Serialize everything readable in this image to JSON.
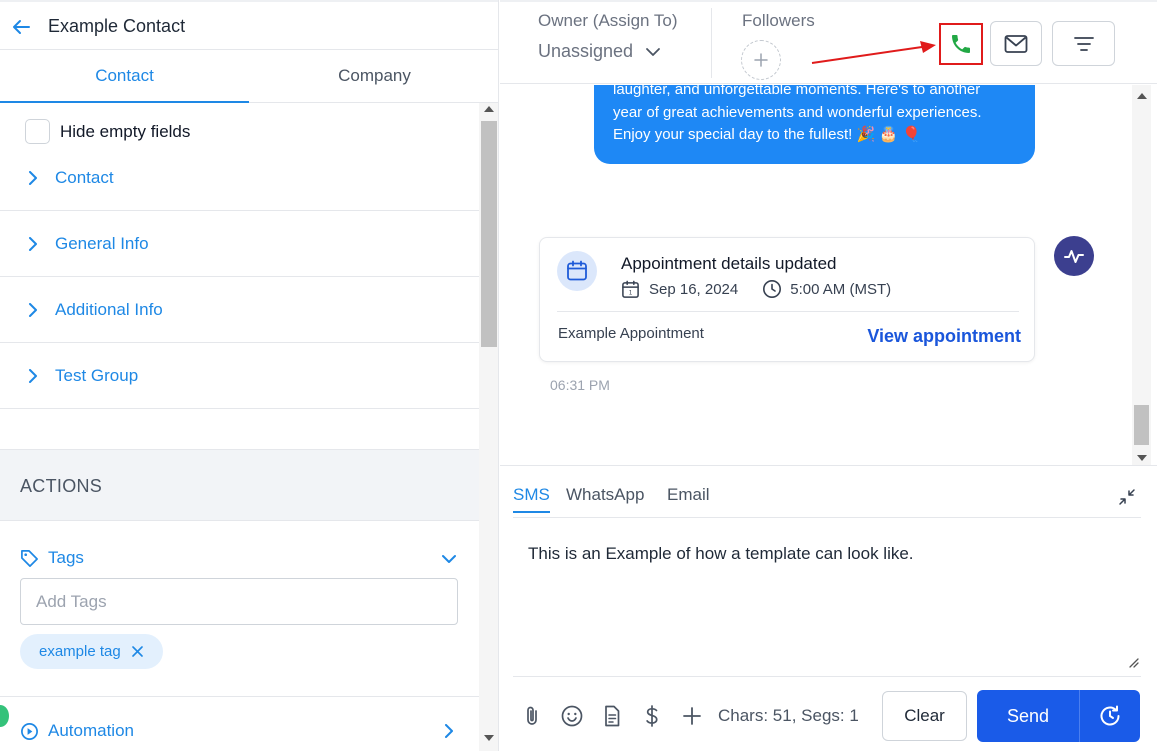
{
  "contact": {
    "name": "Example Contact",
    "tabs": [
      {
        "label": "Contact"
      },
      {
        "label": "Company"
      }
    ],
    "hide_empty_label": "Hide empty fields",
    "sections": [
      {
        "label": "Contact"
      },
      {
        "label": "General Info"
      },
      {
        "label": "Additional Info"
      },
      {
        "label": "Test Group"
      }
    ]
  },
  "actions": {
    "header": "ACTIONS",
    "tags_label": "Tags",
    "tags_placeholder": "Add Tags",
    "tags": [
      {
        "label": "example tag"
      }
    ],
    "automation_label": "Automation"
  },
  "header": {
    "owner_label": "Owner (Assign To)",
    "owner_value": "Unassigned",
    "followers_label": "Followers"
  },
  "conversation": {
    "message_lines": [
      "laughter, and unforgettable moments. Here's to another",
      "year of great achievements and wonderful experiences.",
      "Enjoy your special day to the fullest! 🎉 🎂 🎈"
    ],
    "activity": {
      "title": "Appointment details updated",
      "date": "Sep 16, 2024",
      "time": "5:00 AM (MST)",
      "appointment_name": "Example Appointment",
      "link_label": "View appointment"
    },
    "timestamp": "06:31 PM"
  },
  "composer": {
    "tabs": [
      {
        "label": "SMS"
      },
      {
        "label": "WhatsApp"
      },
      {
        "label": "Email"
      }
    ],
    "message": "This is an Example of how a template can look like.",
    "char_count": "Chars: 51, Segs: 1",
    "clear_label": "Clear",
    "send_label": "Send"
  },
  "colors": {
    "accent": "#1e88e5",
    "send": "#1a5be8",
    "bubble": "#1e88f5",
    "highlight": "#e01b1b",
    "call_icon": "#22a845",
    "avatar": "#3c3f8f"
  },
  "icons": {
    "back": "arrow-left-icon",
    "call": "phone-icon",
    "email": "envelope-icon",
    "filter": "filter-icon",
    "calendar": "calendar-icon",
    "clock": "clock-icon",
    "activity": "activity-pulse-icon",
    "collapse": "collapse-arrows-icon"
  }
}
